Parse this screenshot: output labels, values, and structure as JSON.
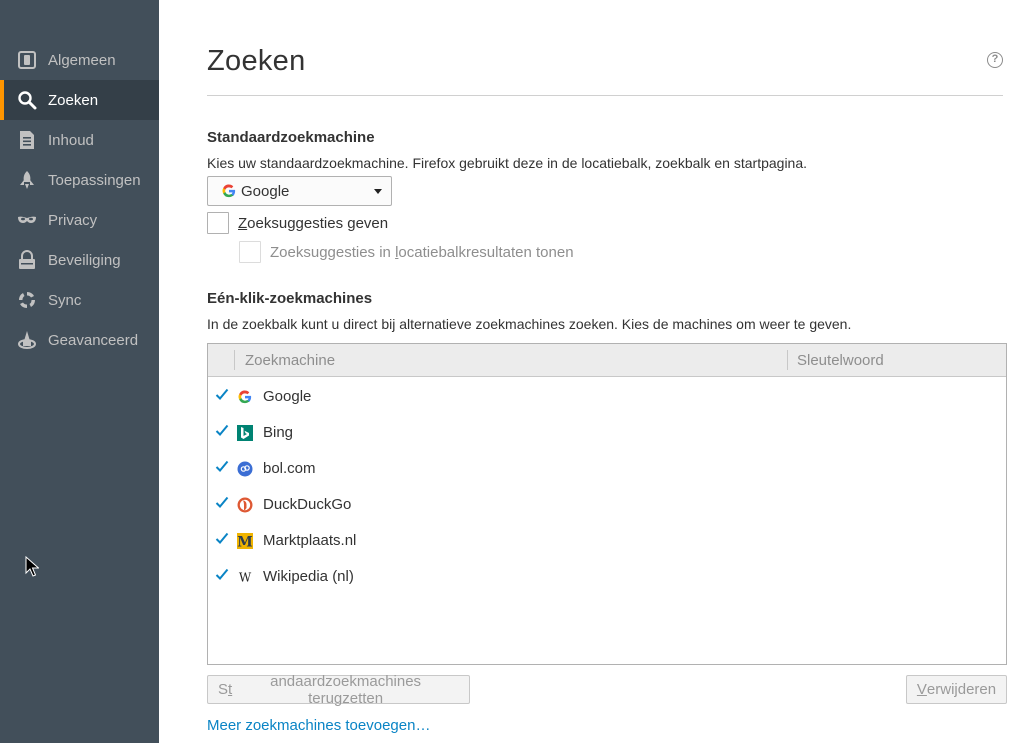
{
  "sidebar": {
    "items": [
      {
        "label": "Algemeen",
        "icon": "general-icon",
        "selected": false
      },
      {
        "label": "Zoeken",
        "icon": "search-icon",
        "selected": true
      },
      {
        "label": "Inhoud",
        "icon": "content-icon",
        "selected": false
      },
      {
        "label": "Toepassingen",
        "icon": "applications-icon",
        "selected": false
      },
      {
        "label": "Privacy",
        "icon": "privacy-mask-icon",
        "selected": false
      },
      {
        "label": "Beveiliging",
        "icon": "security-lock-icon",
        "selected": false
      },
      {
        "label": "Sync",
        "icon": "sync-icon",
        "selected": false
      },
      {
        "label": "Geavanceerd",
        "icon": "advanced-wizard-icon",
        "selected": false
      }
    ],
    "accent": "#ff9500",
    "background": "#424f5a"
  },
  "page": {
    "title": "Zoeken",
    "help_glyph": "?"
  },
  "default_engine": {
    "title": "Standaardzoekmachine",
    "description": "Kies uw standaardzoekmachine. Firefox gebruikt deze in de locatiebalk, zoekbalk en startpagina.",
    "selected": "Google",
    "suggestions_label_prefix": "",
    "suggestions_label_u": "Z",
    "suggestions_label_rest": "oeksuggesties geven",
    "suggestions_checked": false,
    "urlbar_label_prefix": "Zoeksuggesties in ",
    "urlbar_label_u": "l",
    "urlbar_label_rest": "ocatiebalkresultaten tonen",
    "urlbar_checked": false
  },
  "one_click": {
    "title": "Eén-klik-zoekmachines",
    "description": "In de zoekbalk kunt u direct bij alternatieve zoekmachines zoeken. Kies de machines om weer te geven.",
    "columns": [
      "Zoekmachine",
      "Sleutelwoord"
    ],
    "engines": [
      {
        "name": "Google",
        "icon": "google-icon",
        "checked": true,
        "keyword": ""
      },
      {
        "name": "Bing",
        "icon": "bing-icon",
        "checked": true,
        "keyword": ""
      },
      {
        "name": "bol.com",
        "icon": "bolcom-icon",
        "checked": true,
        "keyword": ""
      },
      {
        "name": "DuckDuckGo",
        "icon": "duckduckgo-icon",
        "checked": true,
        "keyword": ""
      },
      {
        "name": "Marktplaats.nl",
        "icon": "marktplaats-icon",
        "checked": true,
        "keyword": ""
      },
      {
        "name": "Wikipedia (nl)",
        "icon": "wikipedia-icon",
        "checked": true,
        "keyword": ""
      }
    ],
    "check_color": "#0a84c5",
    "restore_button_prefix": "S",
    "restore_button_u": "t",
    "restore_button_rest": "andaardzoekmachines terugzetten",
    "remove_button_u": "V",
    "remove_button_rest": "erwijderen",
    "add_link": "Meer zoekmachines toevoegen…"
  }
}
